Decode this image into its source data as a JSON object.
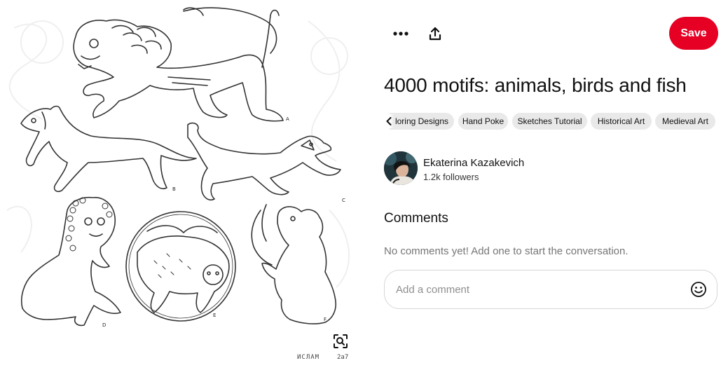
{
  "image": {
    "alt": "4000 motifs: animals, birds and fish",
    "caption": "ИСЛАМ",
    "caption_number": "2a7"
  },
  "toolbar": {
    "more_icon": "ellipsis-icon",
    "share_icon": "share-upload-icon",
    "save_label": "Save"
  },
  "pin": {
    "title": "4000 motifs: animals, birds and fish"
  },
  "tags": [
    {
      "label": "loring Designs"
    },
    {
      "label": "Hand Poke"
    },
    {
      "label": "Sketches Tutorial"
    },
    {
      "label": "Historical Art"
    },
    {
      "label": "Medieval Art"
    }
  ],
  "creator": {
    "name": "Ekaterina Kazakevich",
    "followers": "1.2k followers"
  },
  "comments": {
    "heading": "Comments",
    "empty_text": "No comments yet! Add one to start the conversation.",
    "input_placeholder": "Add a comment"
  },
  "colors": {
    "save_button": "#e60023",
    "tag_chip": "#e9e9e9",
    "muted_text": "#767676"
  }
}
